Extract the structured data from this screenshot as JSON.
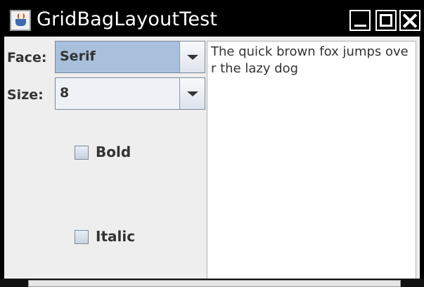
{
  "window": {
    "title": "GridBagLayoutTest"
  },
  "form": {
    "face_label": "Face:",
    "face_value": "Serif",
    "size_label": "Size:",
    "size_value": "8",
    "bold_label": "Bold",
    "italic_label": "Italic"
  },
  "text_area": {
    "content": "The quick brown fox jumps over the lazy dog"
  },
  "icons": {
    "app": "java-app-icon",
    "minimize": "minimize-icon",
    "maximize": "maximize-icon",
    "close": "close-icon",
    "combo_arrow": "chevron-down-icon"
  },
  "colors": {
    "title_bar": "#000000",
    "panel_background": "#eeeeee",
    "selected_combo": "#a8c0dc"
  }
}
